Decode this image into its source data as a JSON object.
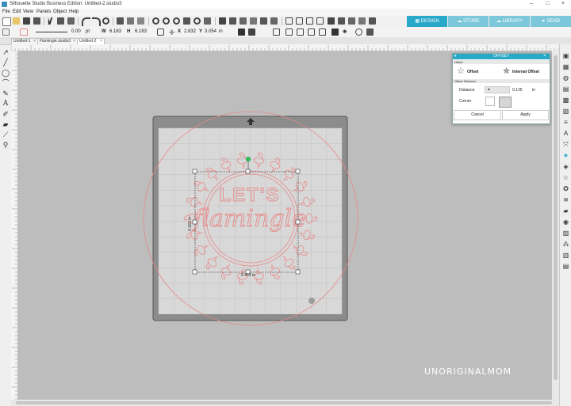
{
  "window": {
    "title": "Silhouette Studio Business Edition: Untitled-2.studio3",
    "minimize": "–",
    "maximize": "□",
    "close": "×"
  },
  "menu": [
    "File",
    "Edit",
    "View",
    "Panels",
    "Object",
    "Help"
  ],
  "toolbar2": {
    "line_width": "0.00",
    "line_unit": "pt",
    "w_label": "W",
    "w_value": "6.183",
    "h_label": "H",
    "h_value": "6.183",
    "x_label": "X",
    "x_value": "2.832",
    "y_label": "Y",
    "y_value": "3.054",
    "units": "in"
  },
  "top_tabs": [
    {
      "label": "DESIGN",
      "color": "#29a8c9"
    },
    {
      "label": "STORE",
      "color": "#7cc7da"
    },
    {
      "label": "LIBRARY",
      "color": "#7cc7da"
    },
    {
      "label": "SEND",
      "color": "#7cc7da"
    }
  ],
  "doc_tabs": [
    "Untitled-1",
    "Flamingle.studio3",
    "Untitled-2"
  ],
  "offset_panel": {
    "title": "OFFSET",
    "section_offset": "Offset",
    "offset_label": "Offset",
    "internal_offset_label": "Internal Offset",
    "section_distance": "Offset Distance",
    "distance_label": "Distance",
    "distance_value": "0.125",
    "distance_unit": "in",
    "corner_label": "Corner",
    "cancel": "Cancel",
    "apply": "Apply"
  },
  "canvas": {
    "design_text_top": "LET'S",
    "design_text_script": "flamingle",
    "width_readout": "6.403 in",
    "height_readout": "6.183 in",
    "accent": "#e88a8a",
    "mat_color": "#8c8c8c"
  },
  "watermark": "UNORIGINALMOM"
}
